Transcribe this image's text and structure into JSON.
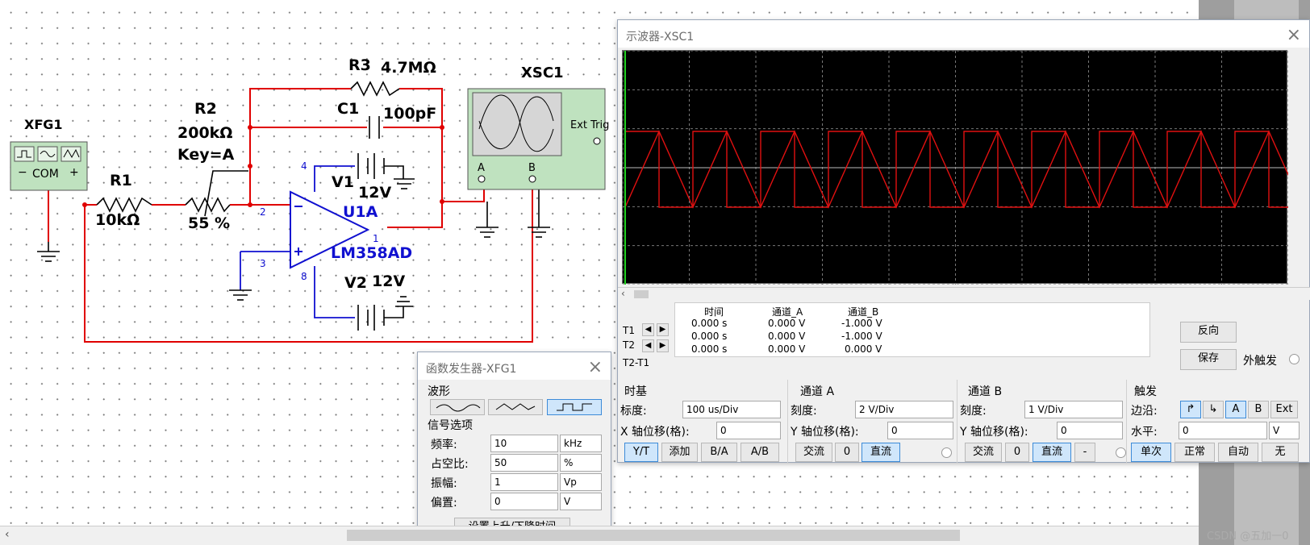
{
  "circuit": {
    "xfg1": {
      "label": "XFG1",
      "com": "COM",
      "minus": "−",
      "plus": "+"
    },
    "r1": {
      "name": "R1",
      "value": "10kΩ"
    },
    "r2": {
      "name": "R2",
      "value": "200kΩ",
      "key": "Key=A",
      "percent": "55 %"
    },
    "r3": {
      "name": "R3",
      "value": "4.7MΩ"
    },
    "c1": {
      "name": "C1",
      "value": "100pF"
    },
    "v1": {
      "name": "V1",
      "value": "12V"
    },
    "v2": {
      "name": "V2",
      "value": "12V"
    },
    "u1a": {
      "name": "U1A",
      "part": "LM358AD",
      "pin1": "1",
      "pin2": "2",
      "pin3": "3",
      "pin4": "4",
      "pin8": "8"
    },
    "xsc1": {
      "label": "XSC1",
      "ext_trig": "Ext Trig",
      "chan_a": "A",
      "chan_b": "B"
    },
    "wire_color": "#e00000"
  },
  "scope": {
    "title": "示波器-XSC1",
    "readout": {
      "headers": [
        "时间",
        "通道_A",
        "通道_B"
      ],
      "rows": [
        {
          "label": "T1",
          "time": "0.000 s",
          "a": "0.000 V",
          "b": "-1.000 V"
        },
        {
          "label": "T2",
          "time": "0.000 s",
          "a": "0.000 V",
          "b": "-1.000 V"
        },
        {
          "label": "T2-T1",
          "time": "0.000 s",
          "a": "0.000 V",
          "b": "0.000 V"
        }
      ]
    },
    "reverse": "反向",
    "save": "保存",
    "ext_trigger": "外触发",
    "timebase": {
      "title": "时基",
      "scale_label": "标度:",
      "scale": "100 us/Div",
      "xpos_label": "X 轴位移(格):",
      "xpos": "0",
      "btns": [
        "Y/T",
        "添加",
        "B/A",
        "A/B"
      ]
    },
    "chan_a": {
      "title": "通道 A",
      "scale_label": "刻度:",
      "scale": "2  V/Div",
      "ypos_label": "Y 轴位移(格):",
      "ypos": "0",
      "btns": [
        "交流",
        "0",
        "直流"
      ]
    },
    "chan_b": {
      "title": "通道 B",
      "scale_label": "刻度:",
      "scale": "1  V/Div",
      "ypos_label": "Y 轴位移(格):",
      "ypos": "0",
      "btns": [
        "交流",
        "0",
        "直流",
        "-"
      ]
    },
    "trigger": {
      "title": "触发",
      "edge_label": "边沿:",
      "level_label": "水平:",
      "level": "0",
      "unit": "V",
      "edge_btns": [
        "↱",
        "↳",
        "A",
        "B",
        "Ext"
      ],
      "mode_btns": [
        "单次",
        "正常",
        "自动",
        "无"
      ]
    },
    "trace_color": "#e01010"
  },
  "fgen": {
    "title": "函数发生器-XFG1",
    "waveform_label": "波形",
    "signal_label": "信号选项",
    "params": [
      {
        "label": "频率:",
        "value": "10",
        "unit": "kHz"
      },
      {
        "label": "占空比:",
        "value": "50",
        "unit": "%"
      },
      {
        "label": "振幅:",
        "value": "1",
        "unit": "Vp"
      },
      {
        "label": "偏置:",
        "value": "0",
        "unit": "V"
      }
    ],
    "rise_fall": "设置上升/下降时间"
  },
  "watermark": "CSDN @五加一0"
}
